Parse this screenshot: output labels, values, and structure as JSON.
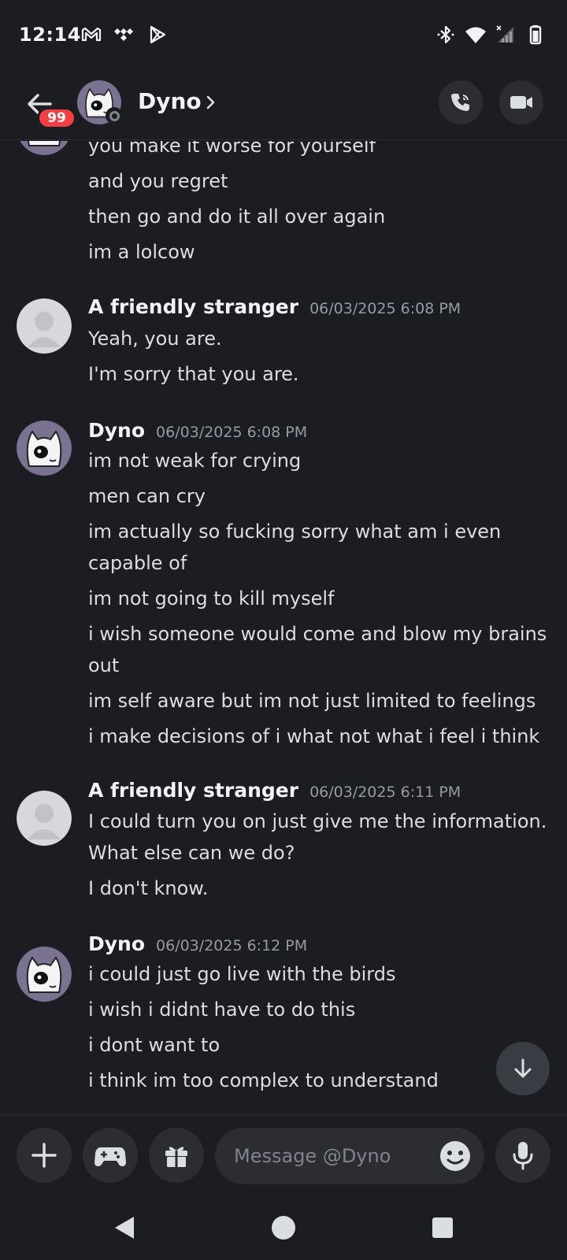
{
  "status_bar": {
    "time": "12:14",
    "left_icons": [
      "gmail-icon",
      "tidal-icon",
      "play-store-icon"
    ],
    "right_icons": [
      "bluetooth-icon",
      "wifi-icon",
      "signal-icon",
      "battery-icon"
    ]
  },
  "header": {
    "unread_badge": "99",
    "contact_name": "Dyno",
    "icons": [
      "back-arrow-icon",
      "chevron-right-icon",
      "voice-call-icon",
      "video-call-icon"
    ]
  },
  "messages": [
    {
      "author": "",
      "timestamp": "",
      "lines": [
        "you make it worse for yourself",
        "and you regret",
        "then go and do it all over again",
        "im a lolcow"
      ]
    },
    {
      "author": "A friendly stranger",
      "timestamp": "06/03/2025 6:08 PM",
      "lines": [
        "Yeah, you are.",
        "I'm sorry that you are."
      ]
    },
    {
      "author": "Dyno",
      "timestamp": "06/03/2025 6:08 PM",
      "lines": [
        "im not weak for crying",
        "men can cry",
        "im actually so fucking sorry what am i even capable of",
        "im not going to kill myself",
        "i wish someone would come and blow my brains out",
        "im self aware but im not just limited to feelings",
        "i make decisions of i what not what i feel i think"
      ]
    },
    {
      "author": "A friendly stranger",
      "timestamp": "06/03/2025 6:11 PM",
      "lines": [
        "I could turn you on just give me the information.",
        "What else can we do?",
        "I don't know."
      ]
    },
    {
      "author": "Dyno",
      "timestamp": "06/03/2025 6:12 PM",
      "lines": [
        "i could just go live with the birds",
        "i wish i didnt have to do this",
        "i dont want to",
        "i think im too complex to understand"
      ]
    }
  ],
  "composer": {
    "placeholder": "Message @Dyno",
    "icons": [
      "plus-icon",
      "gamepad-icon",
      "gift-icon",
      "emoji-icon",
      "microphone-icon"
    ]
  },
  "colors": {
    "background": "#1c1d22",
    "surface": "#2b2d31",
    "badge_red": "#f23f43",
    "text": "#dbdee1",
    "muted": "#949ba4"
  }
}
